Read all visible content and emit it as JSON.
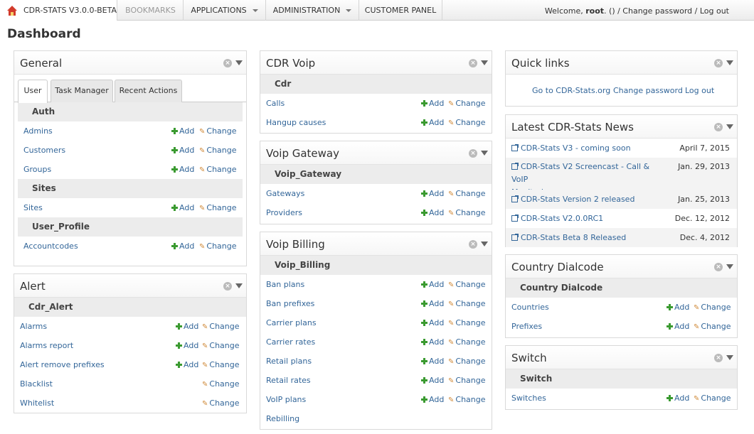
{
  "topbar": {
    "brand": "CDR-STATS V3.0.0-BETA",
    "nav": [
      "BOOKMARKS",
      "APPLICATIONS",
      "ADMINISTRATION",
      "CUSTOMER PANEL"
    ],
    "welcome_prefix": "Welcome,",
    "user": "root",
    "welcome_suffix": ". () / Change password / Log out"
  },
  "page_title": "Dashboard",
  "actions": {
    "add": "Add",
    "change": "Change"
  },
  "general": {
    "title": "General",
    "tabs": [
      "User",
      "Task Manager",
      "Recent Actions"
    ],
    "groups": [
      {
        "name": "Auth",
        "rows": [
          "Admins",
          "Customers",
          "Groups"
        ]
      },
      {
        "name": "Sites",
        "rows": [
          "Sites"
        ]
      },
      {
        "name": "User_Profile",
        "rows": [
          "Accountcodes"
        ]
      }
    ]
  },
  "alert": {
    "title": "Alert",
    "group": "Cdr_Alert",
    "rows": [
      "Alarms",
      "Alarms report",
      "Alert remove prefixes",
      "Blacklist",
      "Whitelist"
    ]
  },
  "cdr_voip": {
    "title": "CDR Voip",
    "group": "Cdr",
    "rows": [
      "Calls",
      "Hangup causes"
    ]
  },
  "voip_gateway": {
    "title": "Voip Gateway",
    "group": "Voip_Gateway",
    "rows": [
      "Gateways",
      "Providers"
    ]
  },
  "voip_billing": {
    "title": "Voip Billing",
    "group": "Voip_Billing",
    "rows": [
      "Ban plans",
      "Ban prefixes",
      "Carrier plans",
      "Carrier rates",
      "Retail plans",
      "Retail rates",
      "VoIP plans",
      "Rebilling"
    ]
  },
  "quick_links": {
    "title": "Quick links",
    "links": [
      "Go to CDR-Stats.org",
      "Change password",
      "Log out"
    ]
  },
  "news": {
    "title": "Latest CDR-Stats News",
    "items": [
      {
        "title": "CDR-Stats V3 - coming soon",
        "date": "April 7, 2015"
      },
      {
        "title_line1": "CDR-Stats V2 Screencast - Call & VoIP",
        "title_line2": "Monitoring",
        "date": "Jan. 29, 2013"
      },
      {
        "title": "CDR-Stats Version 2 released",
        "date": "Jan. 25, 2013"
      },
      {
        "title": "CDR-Stats V2.0.0RC1",
        "date": "Dec. 12, 2012"
      },
      {
        "title": "CDR-Stats Beta 8 Released",
        "date": "Dec. 4, 2012"
      }
    ]
  },
  "country_dialcode": {
    "title": "Country Dialcode",
    "group": "Country Dialcode",
    "rows": [
      "Countries",
      "Prefixes"
    ]
  },
  "switch": {
    "title": "Switch",
    "group": "Switch",
    "rows": [
      "Switches"
    ]
  },
  "colors": {
    "link": "#336699",
    "add_green": "#3a9a30",
    "group_bg": "#ececec"
  }
}
